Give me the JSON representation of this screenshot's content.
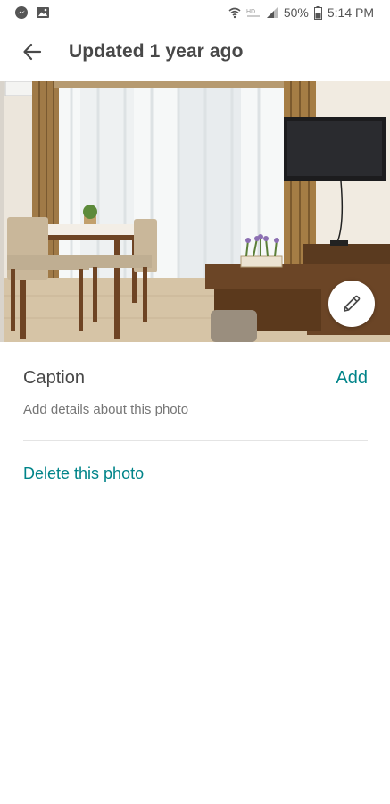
{
  "status_bar": {
    "battery": "50%",
    "time": "5:14 PM",
    "icons": [
      "messenger-icon",
      "image-icon",
      "wifi-icon",
      "hd-icon",
      "signal-icon",
      "battery-icon"
    ]
  },
  "app_bar": {
    "title": "Updated 1 year ago",
    "back_icon": "arrow-left-icon"
  },
  "photo": {
    "subject": "apartment-living-room",
    "edit_icon": "pencil-icon"
  },
  "caption": {
    "label": "Caption",
    "action": "Add",
    "hint": "Add details about this photo"
  },
  "delete_label": "Delete this photo",
  "colors": {
    "accent": "#008489",
    "text": "#484848",
    "muted": "#767676"
  }
}
